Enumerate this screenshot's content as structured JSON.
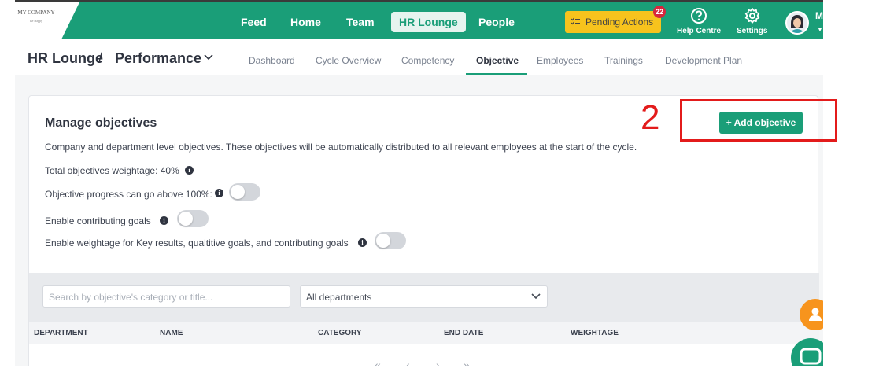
{
  "logo": {
    "name": "MY COMPANY",
    "tagline": "Be Happy"
  },
  "nav": {
    "items": [
      {
        "label": "Feed"
      },
      {
        "label": "Home"
      },
      {
        "label": "Team"
      },
      {
        "label": "HR Lounge",
        "active": true
      },
      {
        "label": "People"
      }
    ],
    "pending_actions": {
      "label": "Pending Actions",
      "count": "22"
    },
    "help": {
      "label": "Help Centre",
      "icon": "question-circle-icon"
    },
    "settings": {
      "label": "Settings",
      "icon": "gear-icon"
    },
    "user": {
      "initial": "M",
      "icon": "avatar"
    }
  },
  "breadcrumb": {
    "section": "HR Lounge",
    "separator": "/",
    "page": "Performance"
  },
  "tabs": [
    {
      "label": "Dashboard"
    },
    {
      "label": "Cycle Overview"
    },
    {
      "label": "Competency"
    },
    {
      "label": "Objective",
      "active": true
    },
    {
      "label": "Employees"
    },
    {
      "label": "Trainings"
    },
    {
      "label": "Development Plan"
    }
  ],
  "manage": {
    "title": "Manage objectives",
    "add_button": "+ Add objective",
    "description": "Company and department level objectives. These objectives will be automatically distributed to all relevant employees at the start of the cycle.",
    "total_weightage": "Total objectives weightage: 40%",
    "settings": [
      {
        "label": "Objective progress can go above 100%:",
        "enabled": false
      },
      {
        "label": "Enable contributing goals",
        "enabled": false
      },
      {
        "label": "Enable weightage for Key results, qualtitive goals, and contributing goals",
        "enabled": false
      }
    ]
  },
  "filters": {
    "search_placeholder": "Search by objective's category or title...",
    "department_selected": "All departments"
  },
  "table": {
    "columns": [
      "DEPARTMENT",
      "NAME",
      "CATEGORY",
      "END DATE",
      "WEIGHTAGE"
    ]
  },
  "pagination": {
    "first": "«",
    "prev": "‹",
    "next": "›",
    "last": "»"
  },
  "annotation": {
    "step_number": "2"
  },
  "colors": {
    "brand": "#1a9e78",
    "pending": "#f7c31d",
    "badge": "#d7263d",
    "annotation": "#e31b1b",
    "fab": "#f7941d"
  }
}
